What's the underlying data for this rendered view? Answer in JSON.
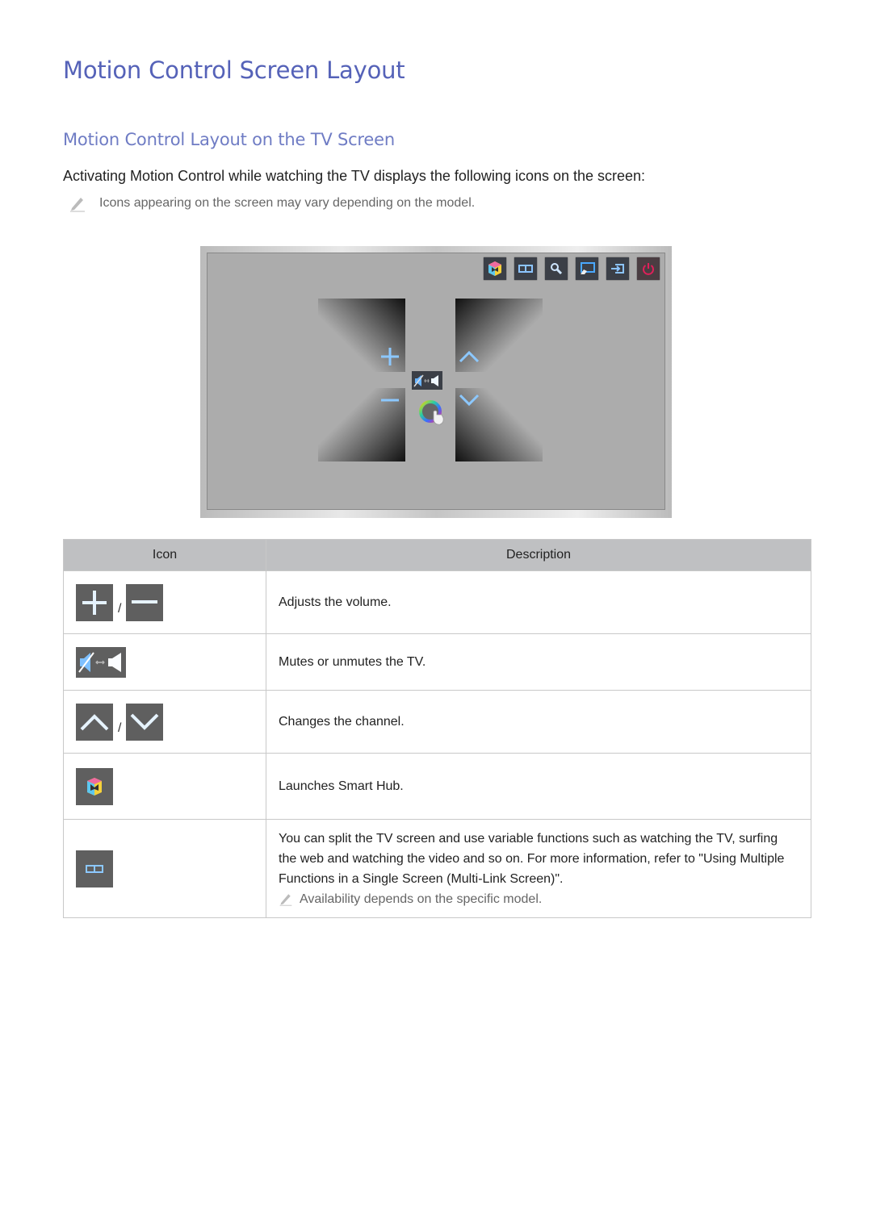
{
  "page": {
    "title": "Motion Control Screen Layout",
    "subtitle": "Motion Control Layout on the TV Screen",
    "intro": "Activating Motion Control while watching the TV displays the following icons on the screen:",
    "note": "Icons appearing on the screen may vary depending on the model."
  },
  "tv_screen": {
    "top_icons": [
      "smart-hub-icon",
      "multi-link-icon",
      "search-icon",
      "screen-touch-icon",
      "source-icon",
      "power-icon"
    ],
    "controls": [
      "volume-up-icon",
      "volume-down-icon",
      "channel-up-icon",
      "channel-down-icon",
      "mute-toggle-icon",
      "hand-cursor-icon"
    ],
    "accent": "#2a8cff",
    "power_color": "#e0205a"
  },
  "table": {
    "headers": [
      "Icon",
      "Description"
    ],
    "separator": "/",
    "rows": [
      {
        "icons": [
          "volume-up-icon",
          "volume-down-icon"
        ],
        "description": "Adjusts the volume."
      },
      {
        "icons": [
          "mute-toggle-icon"
        ],
        "description": "Mutes or unmutes the TV."
      },
      {
        "icons": [
          "channel-up-icon",
          "channel-down-icon"
        ],
        "description": "Changes the channel."
      },
      {
        "icons": [
          "smart-hub-icon"
        ],
        "description": "Launches Smart Hub."
      },
      {
        "icons": [
          "multi-link-icon"
        ],
        "description": "You can split the TV screen and use variable functions such as watching the TV, surfing the web and watching the video and so on. For more information, refer to \"Using Multiple Functions in a Single Screen (Multi-Link Screen)\".",
        "note": "Availability depends on the specific model."
      }
    ]
  }
}
